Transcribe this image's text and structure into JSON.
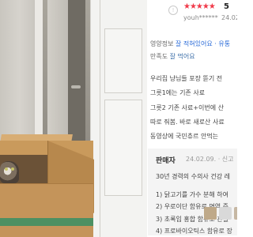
{
  "review": {
    "stars": "★★★★★",
    "rating": "5",
    "user": "youh******",
    "date": "24.02.",
    "attributes": [
      {
        "label": "영양정보",
        "value": "잘 적혀있어요 · 유통"
      },
      {
        "label": "만족도",
        "value": "잘 먹어요"
      }
    ],
    "body_lines": [
      "우리집 냥님들 포장 뜯기 전",
      "그릇1에는 기존 사료",
      "그릇2 기존 사료+이번에 산",
      "따로 줘봄. 바로 새로산 사료",
      "동영상에 국민츄르 안먹는"
    ]
  },
  "seller_reply": {
    "name": "판매자",
    "meta": "24.02.09. · 신고",
    "lines": [
      "30년 경력의 수의사 건강 레",
      "1) 닭고기를 가수 분해 하여",
      "2) 우로이단 함유로 면역 증",
      "3) 초록입 홍합 함유로 관절",
      "4) 프로바이오틱스 함유로 장"
    ]
  },
  "photo": {
    "description_icon": "photo-thumbnail"
  },
  "colors": {
    "star": "#f03a4a",
    "value_link": "#2a6bd8"
  }
}
